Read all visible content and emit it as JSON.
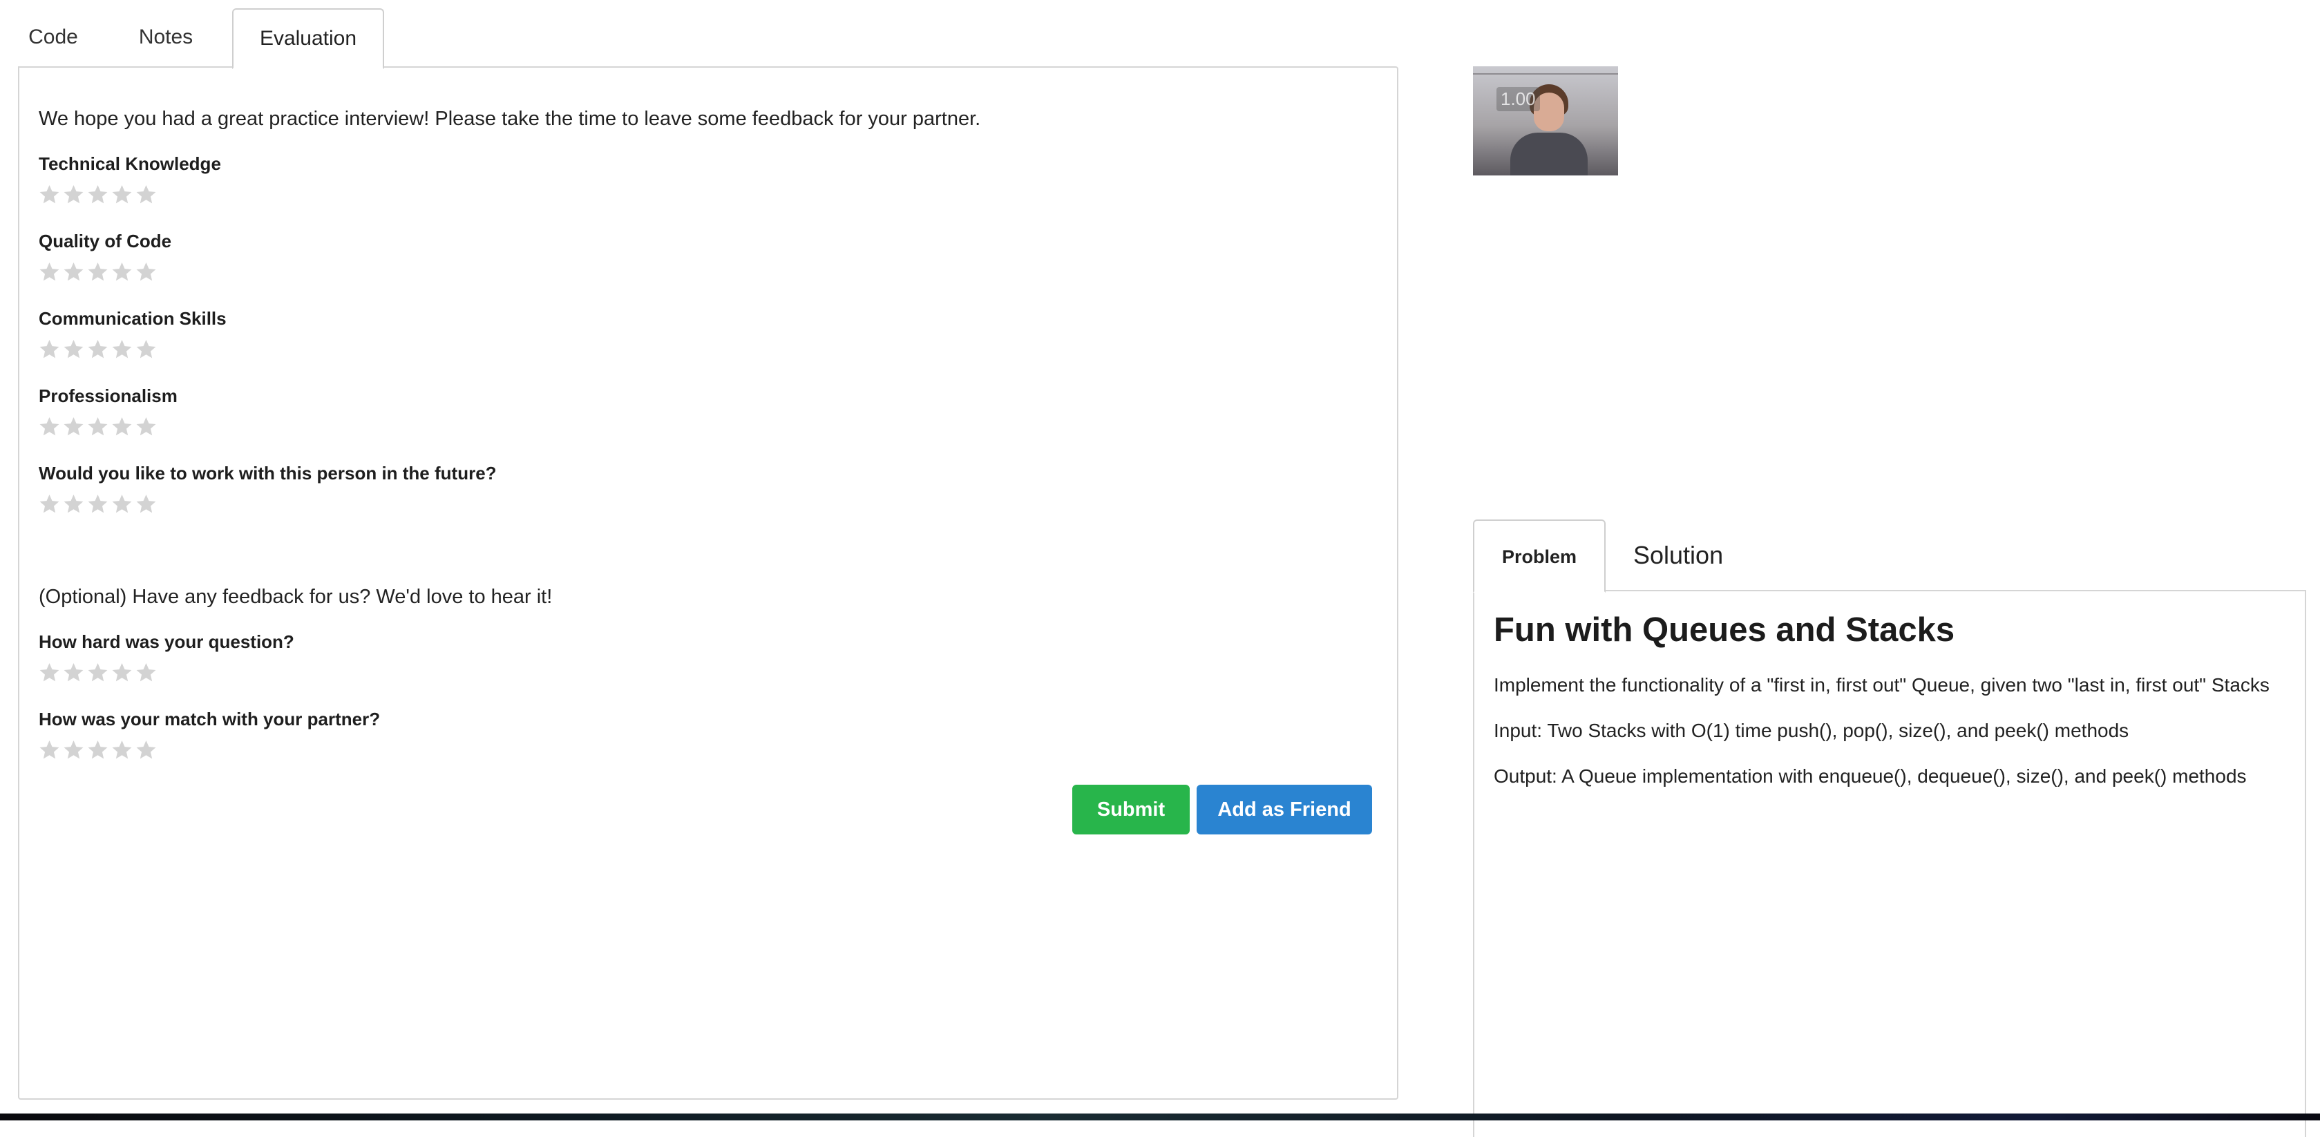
{
  "tabs": {
    "code": "Code",
    "notes": "Notes",
    "evaluation": "Evaluation"
  },
  "evaluation": {
    "intro": "We hope you had a great practice interview! Please take the time to leave some feedback for your partner.",
    "questions": [
      {
        "label": "Technical Knowledge",
        "rating": 0,
        "max": 5
      },
      {
        "label": "Quality of Code",
        "rating": 0,
        "max": 5
      },
      {
        "label": "Communication Skills",
        "rating": 0,
        "max": 5
      },
      {
        "label": "Professionalism",
        "rating": 0,
        "max": 5
      },
      {
        "label": "Would you like to work with this person in the future?",
        "rating": 0,
        "max": 5
      }
    ],
    "optional_prompt": "(Optional) Have any feedback for us? We'd love to hear it!",
    "optional_questions": [
      {
        "label": "How hard was your question?",
        "rating": 0,
        "max": 5
      },
      {
        "label": "How was your match with your partner?",
        "rating": 0,
        "max": 5
      }
    ],
    "submit_label": "Submit",
    "add_friend_label": "Add as Friend"
  },
  "video": {
    "overlay_text": "1.00"
  },
  "problem": {
    "tabs": {
      "problem": "Problem",
      "solution": "Solution"
    },
    "title": "Fun with Queues and Stacks",
    "description": "Implement the functionality of a \"first in, first out\" Queue, given two \"last in, first out\" Stacks",
    "input": "Input: Two Stacks with O(1) time push(), pop(), size(), and peek() methods",
    "output": "Output: A Queue implementation with enqueue(), dequeue(), size(), and peek() methods"
  },
  "colors": {
    "submit": "#28b54b",
    "add_friend": "#2a84d1",
    "star_empty": "#d3d3d3"
  }
}
